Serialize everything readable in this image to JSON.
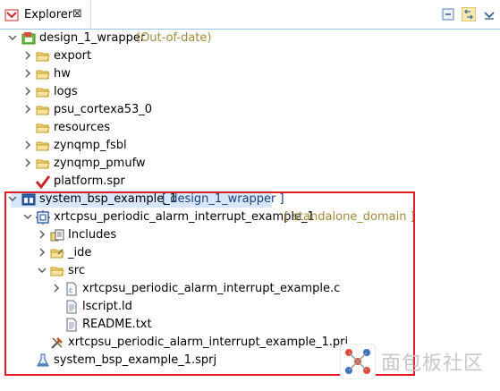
{
  "tab": {
    "label": "Explorer",
    "close": "⊠"
  },
  "tree": [
    {
      "label": "design_1_wrapper",
      "decoration": "(Out-of-date)",
      "expanded": true
    },
    {
      "label": "export"
    },
    {
      "label": "hw"
    },
    {
      "label": "logs"
    },
    {
      "label": "psu_cortexa53_0"
    },
    {
      "label": "resources"
    },
    {
      "label": "zynqmp_fsbl"
    },
    {
      "label": "zynqmp_pmufw"
    },
    {
      "label": "platform.spr"
    },
    {
      "label": "system_bsp_example_1",
      "decoration": "[ design_1_wrapper ]",
      "selected": true
    },
    {
      "label": "xrtcpsu_periodic_alarm_interrupt_example_1",
      "decoration": "[ standalone_domain ]"
    },
    {
      "label": "Includes"
    },
    {
      "label": "_ide"
    },
    {
      "label": "src"
    },
    {
      "label": "xrtcpsu_periodic_alarm_interrupt_example.c"
    },
    {
      "label": "lscript.ld"
    },
    {
      "label": "README.txt"
    },
    {
      "label": "xrtcpsu_periodic_alarm_interrupt_example_1.prj"
    },
    {
      "label": "system_bsp_example_1.sprj"
    }
  ],
  "watermark": {
    "text": "面包板社区"
  }
}
